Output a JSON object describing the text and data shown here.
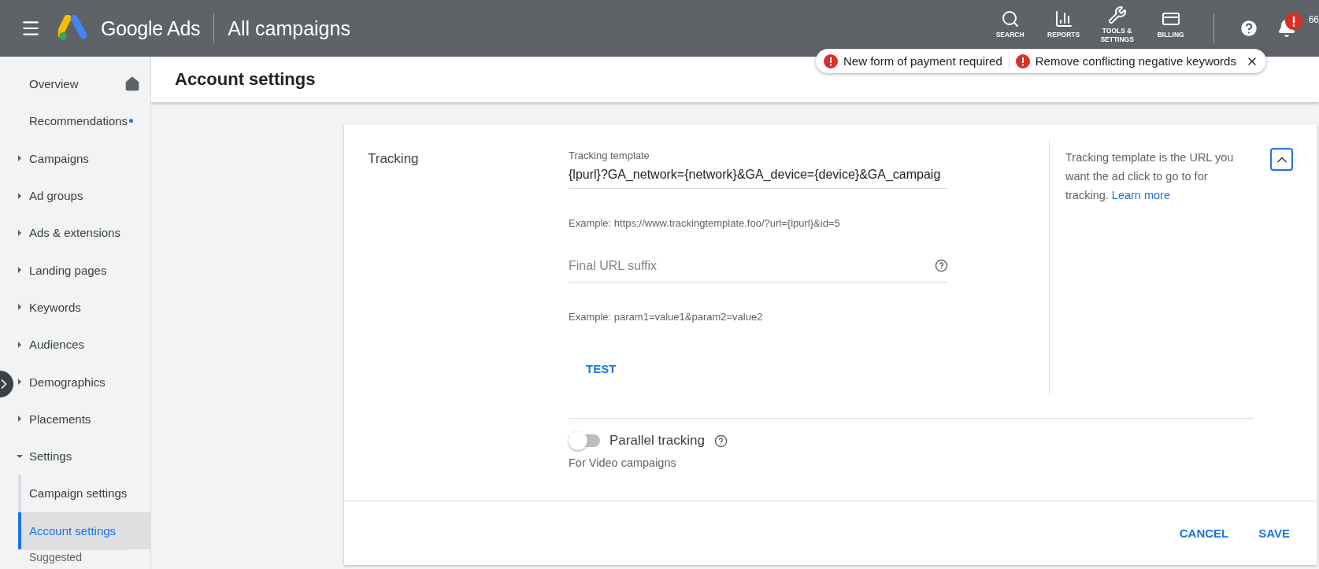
{
  "top_bar": {
    "brand": "Google Ads",
    "page_title": "All campaigns",
    "tools": [
      {
        "kind": "search",
        "label": "SEARCH"
      },
      {
        "kind": "reports",
        "label": "REPORTS"
      },
      {
        "kind": "tools",
        "label": "TOOLS & SETTINGS"
      },
      {
        "kind": "billing",
        "label": "BILLING"
      }
    ],
    "notifications_alert": true,
    "account_fragment": "66"
  },
  "alerts": [
    {
      "text": "New form of payment required"
    },
    {
      "text": "Remove conflicting negative keywords"
    }
  ],
  "sidebar": {
    "items": [
      {
        "kind": "link",
        "label": "Overview",
        "selected": false,
        "home": true
      },
      {
        "kind": "link",
        "label": "Recommendations",
        "selected": false,
        "dot": true
      },
      {
        "kind": "group",
        "label": "Campaigns",
        "expanded": false
      },
      {
        "kind": "group",
        "label": "Ad groups",
        "expanded": false
      },
      {
        "kind": "group",
        "label": "Ads & extensions",
        "expanded": false
      },
      {
        "kind": "group",
        "label": "Landing pages",
        "expanded": false
      },
      {
        "kind": "group",
        "label": "Keywords",
        "expanded": false
      },
      {
        "kind": "group",
        "label": "Audiences",
        "expanded": false
      },
      {
        "kind": "group",
        "label": "Demographics",
        "expanded": false
      },
      {
        "kind": "group",
        "label": "Placements",
        "expanded": false
      },
      {
        "kind": "group",
        "label": "Settings",
        "expanded": true,
        "children": [
          {
            "label": "Campaign settings",
            "selected": false
          },
          {
            "label": "Account settings",
            "selected": true
          }
        ]
      },
      {
        "kind": "section",
        "label": "Suggested"
      }
    ]
  },
  "page_header": "Account settings",
  "card": {
    "title": "Tracking",
    "expanded": true,
    "fields": [
      {
        "label": "Tracking template",
        "value": "{lpurl}?GA_network={network}&GA_device={device}&GA_campaig",
        "hint": "Example: https://www.trackingtemplate.foo/?url={lpurl}&id=5"
      },
      {
        "placeholder": "Final URL suffix",
        "help_icon": true,
        "hint": "Example: param1=value1&param2=value2"
      }
    ],
    "test_button": "TEST",
    "help": {
      "text": "Tracking template is the URL you want the ad click to go to for tracking.",
      "link": "Learn more"
    },
    "parallel_tracking": {
      "label": "Parallel tracking",
      "on": false,
      "note": "For Video campaigns"
    },
    "actions": [
      "CANCEL",
      "SAVE"
    ]
  }
}
